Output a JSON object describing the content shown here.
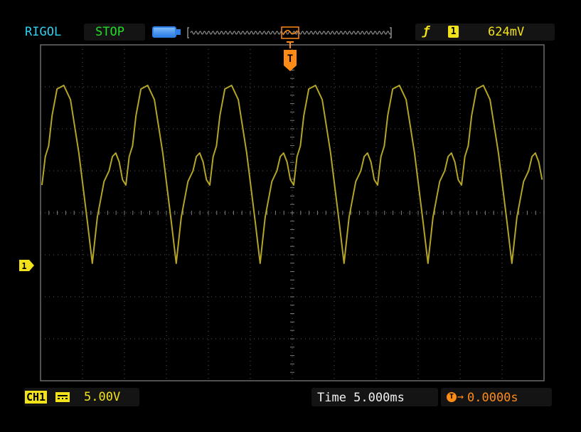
{
  "header": {
    "brand": "RIGOL",
    "run_status": "STOP",
    "trigger_edge_icon": "rising-edge-icon",
    "trigger_source": "1",
    "trigger_level": "624mV"
  },
  "channel": {
    "marker": "1",
    "label": "CH1",
    "coupling_icon": "dc-coupling-icon",
    "scale": "5.00V"
  },
  "timebase": {
    "label": "Time 5.000ms",
    "offset": "0.0000s"
  },
  "trigger_marker": "T",
  "colors": {
    "trace": "#b5a527",
    "brand": "#2fd0ef",
    "status": "#24dc24",
    "channel": "#f2e21a",
    "trigger": "#ff8b17",
    "grid": "#5a5a5a"
  },
  "waveform": {
    "periods": 6,
    "cycle_shape": [
      [
        0.0,
        0.44
      ],
      [
        0.04,
        0.6
      ],
      [
        0.08,
        0.66
      ],
      [
        0.12,
        0.83
      ],
      [
        0.18,
        0.98
      ],
      [
        0.26,
        1.0
      ],
      [
        0.34,
        0.92
      ],
      [
        0.44,
        0.62
      ],
      [
        0.54,
        0.24
      ],
      [
        0.6,
        0.0
      ],
      [
        0.66,
        0.26
      ],
      [
        0.74,
        0.46
      ],
      [
        0.8,
        0.52
      ],
      [
        0.84,
        0.6
      ],
      [
        0.88,
        0.62
      ],
      [
        0.92,
        0.57
      ],
      [
        0.96,
        0.47
      ],
      [
        1.0,
        0.44
      ]
    ]
  }
}
